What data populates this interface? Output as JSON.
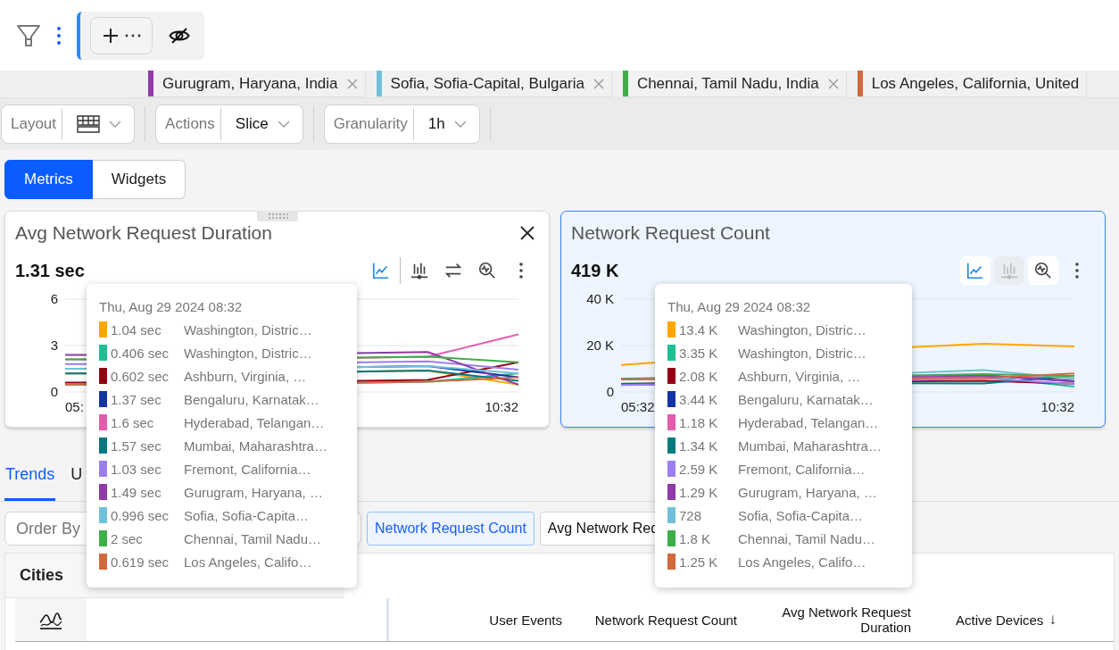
{
  "filter_chips": [
    {
      "label": "Gurugram, Haryana, India",
      "color": "#8e3aa8",
      "removable": true
    },
    {
      "label": "Sofia, Sofia-Capital, Bulgaria",
      "color": "#72c0d8",
      "removable": true
    },
    {
      "label": "Chennai, Tamil Nadu, India",
      "color": "#3fae49",
      "removable": true
    },
    {
      "label": "Los Angeles, California, United",
      "color": "#d2693e",
      "removable": false
    }
  ],
  "controls": [
    {
      "label": "Layout",
      "kind": "icon"
    },
    {
      "label": "Actions",
      "kind": "text",
      "value": "Slice"
    },
    {
      "label": "Granularity",
      "kind": "text",
      "value": "1h"
    }
  ],
  "view_toggle": [
    {
      "label": "Metrics",
      "selected": true
    },
    {
      "label": "Widgets",
      "selected": false
    }
  ],
  "cards": [
    {
      "title": "Avg Network Request Duration",
      "value": "1.31 sec",
      "selected": false,
      "closable": true,
      "tools": [
        {
          "kind": "line",
          "selected": true,
          "disabled": false
        },
        {
          "kind": "bar",
          "selected": false,
          "disabled": false
        },
        {
          "kind": "swap",
          "selected": false,
          "disabled": false
        },
        {
          "kind": "zoom",
          "selected": false,
          "disabled": false
        },
        {
          "kind": "more",
          "selected": false,
          "disabled": false
        }
      ],
      "y_ticks": [
        "6",
        "3",
        "0"
      ],
      "x_labels": [
        "05:",
        "10:32"
      ],
      "tooltip": {
        "date": "Thu, Aug 29 2024 08:32",
        "items": [
          {
            "value": "1.04 sec",
            "label": "Washington, Distric…",
            "color": "#ffa600"
          },
          {
            "value": "0.406 sec",
            "label": "Washington, Distric…",
            "color": "#1fbf95"
          },
          {
            "value": "0.602 sec",
            "label": "Ashburn, Virginia, …",
            "color": "#940014"
          },
          {
            "value": "1.37 sec",
            "label": "Bengaluru, Karnatak…",
            "color": "#1434a4"
          },
          {
            "value": "1.6 sec",
            "label": "Hyderabad, Telangan…",
            "color": "#e35cae"
          },
          {
            "value": "1.57 sec",
            "label": "Mumbai, Maharashtra…",
            "color": "#047a80"
          },
          {
            "value": "1.03 sec",
            "label": "Fremont, California…",
            "color": "#9b7ff0"
          },
          {
            "value": "1.49 sec",
            "label": "Gurugram, Haryana, …",
            "color": "#8e3aa8"
          },
          {
            "value": "0.996 sec",
            "label": "Sofia, Sofia-Capita…",
            "color": "#72c0d8"
          },
          {
            "value": "2 sec",
            "label": "Chennai, Tamil Nadu…",
            "color": "#3fae49"
          },
          {
            "value": "0.619 sec",
            "label": "Los Angeles, Califo…",
            "color": "#d2693e"
          }
        ]
      }
    },
    {
      "title": "Network Request Count",
      "value": "419 K",
      "selected": true,
      "closable": false,
      "tools": [
        {
          "kind": "line",
          "selected": true,
          "disabled": false
        },
        {
          "kind": "bar",
          "selected": false,
          "disabled": true
        },
        {
          "kind": "zoom",
          "selected": false,
          "disabled": false
        },
        {
          "kind": "more",
          "selected": false,
          "disabled": false
        }
      ],
      "y_ticks": [
        "40 K",
        "20 K",
        "0"
      ],
      "x_labels": [
        "05:32",
        "10:32"
      ],
      "tooltip": {
        "date": "Thu, Aug 29 2024 08:32",
        "items": [
          {
            "value": "13.4 K",
            "label": "Washington, Distric…",
            "color": "#ffa600"
          },
          {
            "value": "3.35 K",
            "label": "Washington, Distric…",
            "color": "#1fbf95"
          },
          {
            "value": "2.08 K",
            "label": "Ashburn, Virginia, …",
            "color": "#940014"
          },
          {
            "value": "3.44 K",
            "label": "Bengaluru, Karnatak…",
            "color": "#1434a4"
          },
          {
            "value": "1.18 K",
            "label": "Hyderabad, Telangan…",
            "color": "#e35cae"
          },
          {
            "value": "1.34 K",
            "label": "Mumbai, Maharashtra…",
            "color": "#047a80"
          },
          {
            "value": "2.59 K",
            "label": "Fremont, California…",
            "color": "#9b7ff0"
          },
          {
            "value": "1.29 K",
            "label": "Gurugram, Haryana, …",
            "color": "#8e3aa8"
          },
          {
            "value": "728",
            "label": "Sofia, Sofia-Capita…",
            "color": "#72c0d8"
          },
          {
            "value": "1.8 K",
            "label": "Chennai, Tamil Nadu…",
            "color": "#3fae49"
          },
          {
            "value": "1.25 K",
            "label": "Los Angeles, Califo…",
            "color": "#d2693e"
          }
        ]
      }
    }
  ],
  "tabs": [
    {
      "label": "Trends",
      "selected": true
    },
    {
      "label": "U",
      "selected": false
    }
  ],
  "order_by": {
    "label": "Order By"
  },
  "metric_chips": [
    {
      "label": "Network Request Count",
      "selected": true
    },
    {
      "label": "Avg Network Req",
      "selected": false
    }
  ],
  "panel": {
    "title": "Cities",
    "columns": [
      {
        "label": "User Events"
      },
      {
        "label": "Network Request Count"
      },
      {
        "label": "Avg Network Request Duration"
      },
      {
        "label": "Active Devices",
        "sort_mark": "↓"
      }
    ]
  }
}
